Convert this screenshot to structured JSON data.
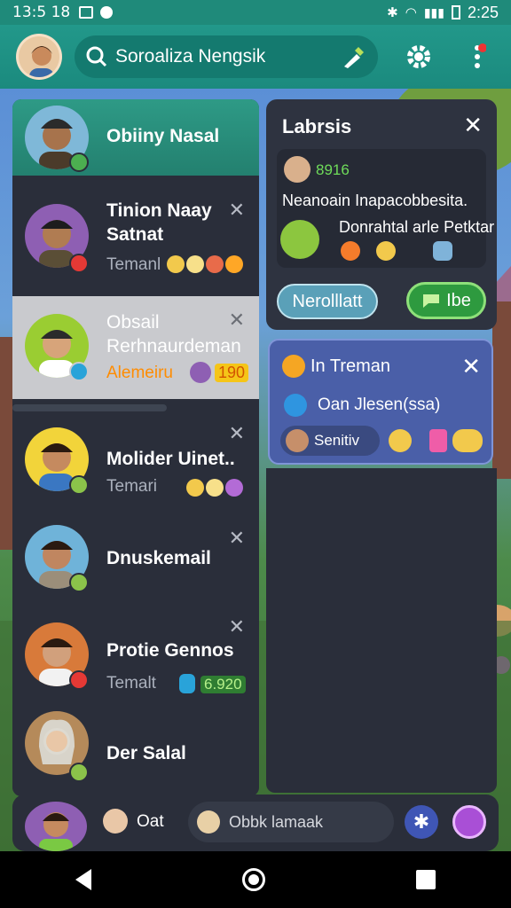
{
  "status_bar": {
    "time": "13:5 18",
    "clock_right": "2:25"
  },
  "app_bar": {
    "search_text": "Soroaliza Nengsik"
  },
  "contacts": [
    {
      "name": "Obiiny Nasal",
      "subtitle": "",
      "extra": ""
    },
    {
      "name": "Tinion Naay\nSatnat",
      "subtitle": "Temanl",
      "extra": ""
    },
    {
      "name": "Obsail\nRerhnaurdeman",
      "subtitle": "Alemeiru",
      "extra": "190"
    },
    {
      "name": "Molider Uinet..",
      "subtitle": "Temari",
      "extra": ""
    },
    {
      "name": "Dnuskemail",
      "subtitle": "",
      "extra": ""
    },
    {
      "name": "Protie Gennos",
      "subtitle": "Temalt",
      "extra": "6.920"
    },
    {
      "name": "Der Salal",
      "subtitle": "",
      "extra": ""
    }
  ],
  "panel_top": {
    "title": "Labrsis",
    "badge_num": "8916",
    "line1": "Neanoain Inapacobbesita.",
    "line2": "Donrahtal arle Petktar",
    "btn_left": "Nerolllatt",
    "btn_right": "Ibe"
  },
  "panel_mid": {
    "title": "In Treman",
    "line": "Oan Jlesen(ssa)",
    "chip": "Senitiv"
  },
  "bottom": {
    "name": "Oat",
    "field": "Obbk lamaak"
  }
}
